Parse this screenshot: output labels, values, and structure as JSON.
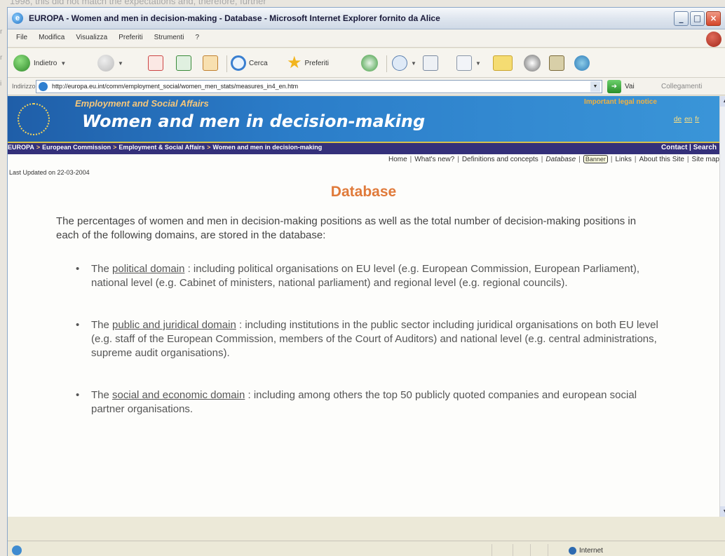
{
  "background": {
    "top_text": "1998, this did not match the expectations and, therefore, further",
    "side_letters": [
      "r",
      "r",
      "i"
    ]
  },
  "window": {
    "title": "EUROPA - Women and men in decision-making - Database - Microsoft Internet Explorer fornito da Alice",
    "controls": {
      "minimize": "_",
      "maximize": "□",
      "close": "×"
    }
  },
  "menu": [
    "File",
    "Modifica",
    "Visualizza",
    "Preferiti",
    "Strumenti",
    "?"
  ],
  "toolbar": {
    "back_label": "Indietro",
    "search_label": "Cerca",
    "favorites_label": "Preferiti",
    "colors": {
      "back": "#3fa037",
      "search": "#3a7fd0",
      "favorites": "#f2b51f"
    }
  },
  "address": {
    "label": "Indirizzo",
    "url": "http://europa.eu.int/comm/employment_social/women_men_stats/measures_in4_en.htm",
    "go_label": "Vai",
    "links_label": "Collegamenti"
  },
  "site": {
    "department": "Employment and Social Affairs",
    "title": "Women and men in decision-making",
    "legal_notice": "Important legal notice",
    "languages": [
      "de",
      "en",
      "fr"
    ],
    "breadcrumbs": [
      "EUROPA",
      "European Commission",
      "Employment & Social Affairs",
      "Women and men in decision-making"
    ],
    "contact_label": "Contact",
    "search_label": "Search",
    "nav": [
      "Home",
      "What's new?",
      "Definitions and concepts",
      "Database",
      "Banner",
      "Links",
      "About this Site",
      "Site map"
    ],
    "last_updated": "Last Updated on 22-03-2004",
    "heading": "Database",
    "colors": {
      "header": "#2b7dc9",
      "crumbbar": "#34307a",
      "heading": "#e07a3a"
    }
  },
  "content": {
    "intro": "The percentages of women and men in decision-making positions as well as the total number of decision-making positions in each of the following domains, are stored in the database:",
    "domains": [
      {
        "prefix": "The",
        "link": "political domain",
        "text": ": including political organisations on EU level (e.g. European Commission, European Parliament), national level (e.g. Cabinet of ministers, national parliament) and regional level (e.g. regional councils)."
      },
      {
        "prefix": "The",
        "link": "public and juridical domain",
        "text": ": including institutions in the public sector including juridical organisations on both EU level (e.g. staff of the European Commission, members of the Court of Auditors) and national level (e.g. central administrations, supreme audit organisations)."
      },
      {
        "prefix": "The",
        "link": "social and economic domain",
        "text": ": including among others the top 50 publicly quoted companies and european social partner organisations."
      }
    ]
  },
  "status": {
    "zone": "Internet"
  }
}
